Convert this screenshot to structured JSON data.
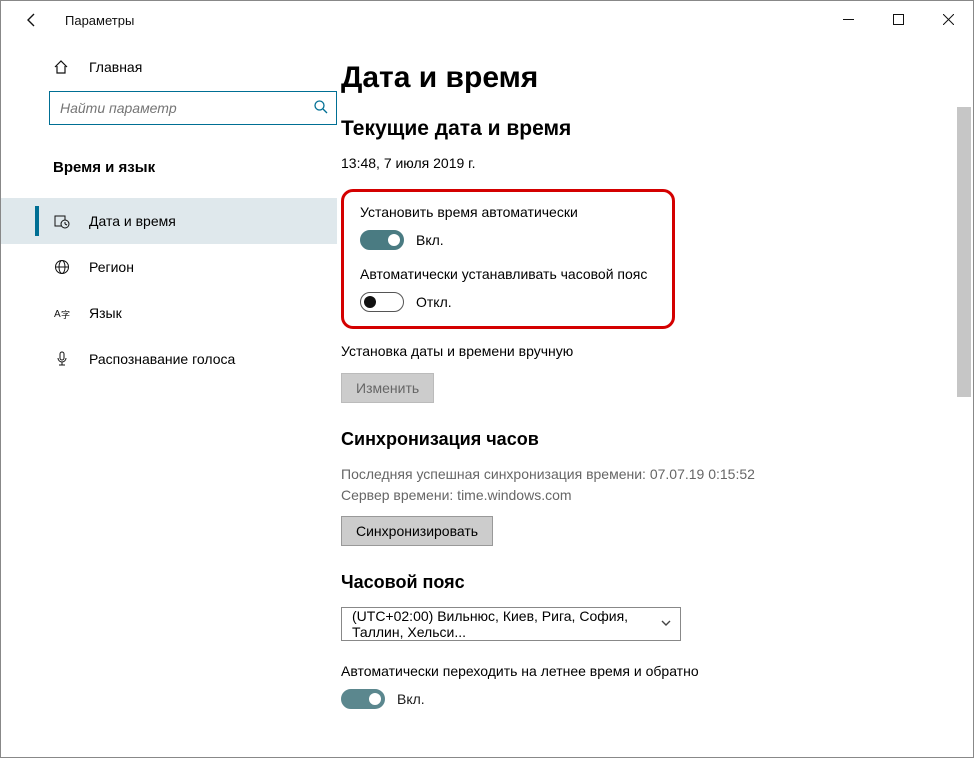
{
  "window": {
    "title": "Параметры"
  },
  "sidebar": {
    "home": "Главная",
    "search_placeholder": "Найти параметр",
    "category": "Время и язык",
    "items": [
      {
        "label": "Дата и время"
      },
      {
        "label": "Регион"
      },
      {
        "label": "Язык"
      },
      {
        "label": "Распознавание голоса"
      }
    ]
  },
  "main": {
    "heading": "Дата и время",
    "current_section": "Текущие дата и время",
    "current_value": "13:48, 7 июля 2019 г.",
    "auto_time_label": "Установить время автоматически",
    "auto_time_state": "Вкл.",
    "auto_tz_label": "Автоматически устанавливать часовой пояс",
    "auto_tz_state": "Откл.",
    "manual_label": "Установка даты и времени вручную",
    "change_button": "Изменить",
    "sync_heading": "Синхронизация часов",
    "sync_last": "Последняя успешная синхронизация времени: 07.07.19 0:15:52",
    "sync_server": "Сервер времени: time.windows.com",
    "sync_button": "Синхронизировать",
    "tz_heading": "Часовой пояс",
    "tz_value": "(UTC+02:00) Вильнюс, Киев, Рига, София, Таллин, Хельси...",
    "dst_label": "Автоматически переходить на летнее время и обратно",
    "dst_state": "Вкл."
  }
}
